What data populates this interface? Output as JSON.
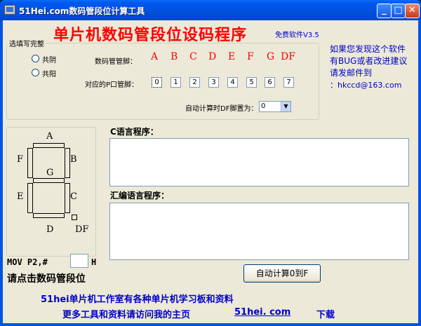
{
  "window": {
    "title": "51Hei.com数码管段位计算工具",
    "min_icon": "minimize-icon",
    "max_icon": "maximize-icon",
    "close_icon": "close-icon"
  },
  "header": {
    "title": "单片机数码管段位设码程序",
    "version": "免费软件V3.5"
  },
  "options": {
    "legend": "选填写完整",
    "radio_common_cathode": "共阴",
    "radio_common_anode": "共阳",
    "selected": ""
  },
  "pins": {
    "seg_label": "数码管管脚：",
    "port_label": "对应的P口管脚：",
    "segments": [
      "A",
      "B",
      "C",
      "D",
      "E",
      "F",
      "G",
      "DF"
    ],
    "values": [
      "0",
      "1",
      "2",
      "3",
      "4",
      "5",
      "6",
      "7"
    ],
    "auto_df_label": "自动计算时DF脚置为：",
    "auto_df_value": "0"
  },
  "side_info": {
    "line1": "如果您发现这个软件",
    "line2": "有BUG或者改进建议",
    "line3": "请发邮件到",
    "email": "：hkccd@163.com"
  },
  "display": {
    "A": "A",
    "B": "B",
    "C": "C",
    "D": "D",
    "E": "E",
    "F": "F",
    "G": "G",
    "DF": "DF"
  },
  "code": {
    "c_label": "C语言程序：",
    "asm_label": "汇编语言程序：",
    "c_text": "",
    "asm_text": ""
  },
  "mov": {
    "prefix": "MOV  P2,#",
    "value": "",
    "suffix": "H",
    "hint": "请点击数码管段位"
  },
  "actions": {
    "auto_calc": "自动计算0到F"
  },
  "footer": {
    "line1": "51hei单片机工作室有各种单片机学习板和资料",
    "line2": "更多工具和资料请访问我的主页",
    "link": "51hei. com",
    "download": "下载"
  },
  "colors": {
    "title_red": "#ff0000",
    "info_blue": "#0000cc",
    "titlebar_blue": "#0054e3",
    "client_bg": "#ece9d8"
  }
}
